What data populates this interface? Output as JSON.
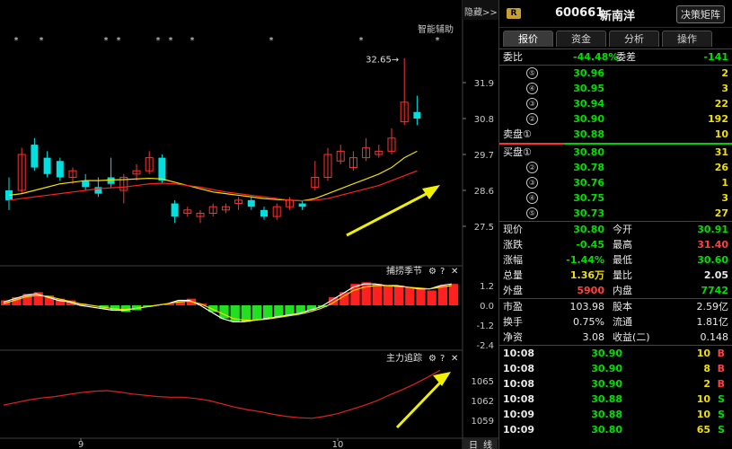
{
  "header": {
    "hide_label": "隐藏>>",
    "smart_assist": "智能辅助",
    "peak_label": "32.65"
  },
  "price_axis": [
    "31.9",
    "30.8",
    "29.7",
    "28.6",
    "27.5"
  ],
  "indicator1": {
    "title": "捕捞季节",
    "axis": [
      "1.2",
      "0.0",
      "-1.2",
      "-2.4"
    ]
  },
  "indicator2": {
    "title": "主力追踪",
    "axis": [
      "1065",
      "1062",
      "1059"
    ]
  },
  "x_labels": [
    "9",
    "10"
  ],
  "period_buttons": [
    "日",
    "线"
  ],
  "panel_icons": [
    "gear-icon",
    "help-icon",
    "close-icon"
  ],
  "stars": [
    "*",
    "*",
    "*",
    "*",
    "*",
    "*",
    "*",
    "*",
    "*",
    "*"
  ],
  "chart_data": {
    "type": "candlestick",
    "candles": [
      {
        "o": 28.6,
        "c": 28.3,
        "h": 29.0,
        "l": 28.0
      },
      {
        "o": 28.6,
        "c": 29.7,
        "h": 29.9,
        "l": 28.5
      },
      {
        "o": 30.0,
        "c": 29.3,
        "h": 30.2,
        "l": 29.2
      },
      {
        "o": 29.6,
        "c": 29.1,
        "h": 29.8,
        "l": 29.0
      },
      {
        "o": 29.5,
        "c": 29.0,
        "h": 29.6,
        "l": 28.9
      },
      {
        "o": 29.0,
        "c": 29.2,
        "h": 29.3,
        "l": 28.8
      },
      {
        "o": 28.9,
        "c": 28.7,
        "h": 29.1,
        "l": 28.6
      },
      {
        "o": 28.7,
        "c": 28.5,
        "h": 29.0,
        "l": 28.4
      },
      {
        "o": 29.0,
        "c": 28.8,
        "h": 29.6,
        "l": 28.7
      },
      {
        "o": 28.6,
        "c": 29.0,
        "h": 29.1,
        "l": 28.2
      },
      {
        "o": 29.1,
        "c": 29.2,
        "h": 29.4,
        "l": 28.9
      },
      {
        "o": 29.2,
        "c": 29.6,
        "h": 29.8,
        "l": 29.1
      },
      {
        "o": 29.6,
        "c": 28.9,
        "h": 29.7,
        "l": 28.8
      },
      {
        "o": 28.2,
        "c": 27.8,
        "h": 28.3,
        "l": 27.6
      },
      {
        "o": 27.9,
        "c": 28.0,
        "h": 28.1,
        "l": 27.8
      },
      {
        "o": 27.8,
        "c": 27.9,
        "h": 28.0,
        "l": 27.6
      },
      {
        "o": 27.9,
        "c": 28.1,
        "h": 28.2,
        "l": 27.8
      },
      {
        "o": 28.0,
        "c": 28.1,
        "h": 28.2,
        "l": 27.9
      },
      {
        "o": 28.2,
        "c": 28.3,
        "h": 28.4,
        "l": 28.0
      },
      {
        "o": 28.3,
        "c": 28.1,
        "h": 28.4,
        "l": 28.0
      },
      {
        "o": 28.0,
        "c": 27.8,
        "h": 28.1,
        "l": 27.7
      },
      {
        "o": 27.8,
        "c": 28.1,
        "h": 28.2,
        "l": 27.7
      },
      {
        "o": 28.1,
        "c": 28.3,
        "h": 28.4,
        "l": 28.0
      },
      {
        "o": 28.2,
        "c": 28.1,
        "h": 28.3,
        "l": 28.0
      },
      {
        "o": 28.7,
        "c": 29.0,
        "h": 29.5,
        "l": 28.6
      },
      {
        "o": 29.0,
        "c": 29.7,
        "h": 29.9,
        "l": 28.9
      },
      {
        "o": 29.5,
        "c": 29.8,
        "h": 30.0,
        "l": 29.4
      },
      {
        "o": 29.3,
        "c": 29.6,
        "h": 29.8,
        "l": 29.2
      },
      {
        "o": 29.6,
        "c": 29.9,
        "h": 30.2,
        "l": 29.5
      },
      {
        "o": 29.7,
        "c": 29.8,
        "h": 30.0,
        "l": 29.6
      },
      {
        "o": 29.8,
        "c": 30.2,
        "h": 30.5,
        "l": 29.7
      },
      {
        "o": 30.7,
        "c": 31.3,
        "h": 32.65,
        "l": 30.6
      },
      {
        "o": 31.0,
        "c": 30.8,
        "h": 31.5,
        "l": 30.6
      }
    ],
    "ma_yellow": [
      28.45,
      28.5,
      28.6,
      28.7,
      28.8,
      28.85,
      28.9,
      28.9,
      28.92,
      28.93,
      28.95,
      28.97,
      28.95,
      28.85,
      28.75,
      28.65,
      28.55,
      28.5,
      28.45,
      28.4,
      28.35,
      28.32,
      28.3,
      28.28,
      28.35,
      28.5,
      28.65,
      28.8,
      28.95,
      29.1,
      29.3,
      29.6,
      29.8
    ],
    "ma_red": [
      28.3,
      28.35,
      28.4,
      28.45,
      28.5,
      28.55,
      28.6,
      28.65,
      28.68,
      28.7,
      28.75,
      28.8,
      28.82,
      28.8,
      28.75,
      28.7,
      28.62,
      28.55,
      28.5,
      28.45,
      28.4,
      28.35,
      28.3,
      28.28,
      28.3,
      28.35,
      28.45,
      28.55,
      28.65,
      28.75,
      28.9,
      29.05,
      29.2
    ],
    "macd_hist": [
      0.3,
      0.5,
      0.7,
      0.8,
      0.6,
      0.4,
      0.3,
      0.1,
      0.0,
      -0.2,
      -0.3,
      -0.4,
      -0.3,
      -0.1,
      0.0,
      0.1,
      0.3,
      0.4,
      0.1,
      -0.4,
      -0.8,
      -1.0,
      -1.0,
      -0.9,
      -0.8,
      -0.7,
      -0.6,
      -0.5,
      -0.3,
      -0.1,
      0.5,
      0.8,
      1.3,
      1.4,
      1.3,
      1.2,
      1.2,
      1.1,
      1.0,
      0.9,
      1.2,
      1.3
    ],
    "macd_line_a": [
      0.2,
      0.4,
      0.6,
      0.7,
      0.5,
      0.3,
      0.2,
      0.0,
      -0.1,
      -0.2,
      -0.3,
      -0.3,
      -0.2,
      -0.1,
      0.0,
      0.1,
      0.3,
      0.3,
      0.0,
      -0.4,
      -0.8,
      -1.0,
      -1.0,
      -0.9,
      -0.8,
      -0.7,
      -0.6,
      -0.5,
      -0.3,
      -0.1,
      0.3,
      0.7,
      1.1,
      1.3,
      1.3,
      1.2,
      1.2,
      1.1,
      1.0,
      1.0,
      1.2,
      1.3
    ],
    "macd_line_b": [
      0.1,
      0.3,
      0.5,
      0.6,
      0.55,
      0.4,
      0.25,
      0.1,
      0.0,
      -0.1,
      -0.2,
      -0.25,
      -0.2,
      -0.1,
      0.0,
      0.1,
      0.2,
      0.25,
      0.1,
      -0.2,
      -0.5,
      -0.8,
      -0.9,
      -0.9,
      -0.85,
      -0.75,
      -0.65,
      -0.55,
      -0.4,
      -0.2,
      0.1,
      0.5,
      0.9,
      1.1,
      1.2,
      1.2,
      1.15,
      1.1,
      1.05,
      1.0,
      1.1,
      1.2
    ],
    "main_force": [
      1061.3,
      1061.7,
      1062.1,
      1062.4,
      1062.6,
      1062.9,
      1063.2,
      1063.4,
      1063.5,
      1063.3,
      1063.0,
      1062.8,
      1062.6,
      1062.5,
      1062.5,
      1062.3,
      1062.0,
      1061.5,
      1061.0,
      1060.6,
      1060.3,
      1059.9,
      1059.6,
      1059.4,
      1059.3,
      1059.6,
      1060.0,
      1060.6,
      1061.2,
      1061.9,
      1062.8,
      1063.6,
      1064.5,
      1065.5,
      1066.6
    ]
  },
  "panel": {
    "code": "600661",
    "name": "新南洋",
    "badge": "R",
    "decision_button": "决策矩阵",
    "tabs": [
      "报价",
      "资金",
      "分析",
      "操作"
    ],
    "weibi_label": "委比",
    "weibi": "-44.48%",
    "weicha_label": "委差",
    "weicha": "-141",
    "asks": [
      {
        "n": "⑤",
        "price": "30.96",
        "vol": "2"
      },
      {
        "n": "④",
        "price": "30.95",
        "vol": "3"
      },
      {
        "n": "③",
        "price": "30.94",
        "vol": "22"
      },
      {
        "n": "②",
        "price": "30.90",
        "vol": "192"
      },
      {
        "n": "卖盘①",
        "price": "30.88",
        "vol": "10"
      }
    ],
    "bids": [
      {
        "n": "买盘①",
        "price": "30.80",
        "vol": "31"
      },
      {
        "n": "②",
        "price": "30.78",
        "vol": "26"
      },
      {
        "n": "③",
        "price": "30.76",
        "vol": "1"
      },
      {
        "n": "④",
        "price": "30.75",
        "vol": "3"
      },
      {
        "n": "⑤",
        "price": "30.73",
        "vol": "27"
      }
    ],
    "quote": [
      {
        "l1": "现价",
        "v1": "30.80",
        "c1": "green",
        "l2": "今开",
        "v2": "30.91",
        "c2": "green"
      },
      {
        "l1": "涨跌",
        "v1": "-0.45",
        "c1": "green",
        "l2": "最高",
        "v2": "31.40",
        "c2": "red"
      },
      {
        "l1": "涨幅",
        "v1": "-1.44%",
        "c1": "green",
        "l2": "最低",
        "v2": "30.60",
        "c2": "green"
      },
      {
        "l1": "总量",
        "v1": "1.36万",
        "c1": "yellow",
        "l2": "量比",
        "v2": "2.05",
        "c2": "white"
      },
      {
        "l1": "外盘",
        "v1": "5900",
        "c1": "red",
        "l2": "内盘",
        "v2": "7742",
        "c2": "green"
      }
    ],
    "fundamentals": [
      {
        "l1": "市盈",
        "v1": "103.98",
        "l2": "股本",
        "v2": "2.59亿"
      },
      {
        "l1": "换手",
        "v1": "0.75%",
        "l2": "流通",
        "v2": "1.81亿"
      },
      {
        "l1": "净资",
        "v1": "3.08",
        "l2": "收益(二)",
        "v2": "0.148"
      }
    ],
    "ticks": [
      {
        "time": "10:08",
        "price": "30.90",
        "vol": "10",
        "side": "B"
      },
      {
        "time": "10:08",
        "price": "30.90",
        "vol": "8",
        "side": "B"
      },
      {
        "time": "10:08",
        "price": "30.90",
        "vol": "2",
        "side": "B"
      },
      {
        "time": "10:08",
        "price": "30.88",
        "vol": "10",
        "side": "S"
      },
      {
        "time": "10:09",
        "price": "30.88",
        "vol": "10",
        "side": "S"
      },
      {
        "time": "10:09",
        "price": "30.80",
        "vol": "65",
        "side": "S"
      }
    ]
  },
  "colors": {
    "up": "#ff3030",
    "down": "#00e0e0",
    "ma1": "#f0e000",
    "ma2": "#ff2020",
    "arrow": "#f0f000"
  }
}
